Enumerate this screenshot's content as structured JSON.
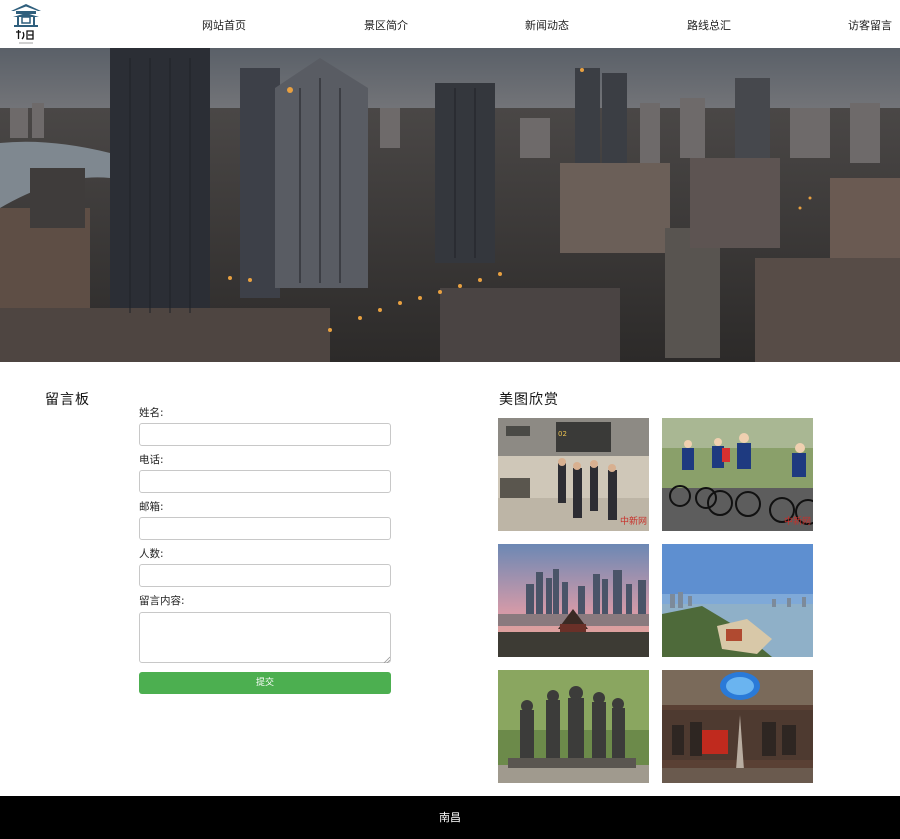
{
  "header": {
    "logo_icon": "nanchang-pavilion-logo",
    "nav": [
      {
        "label": "网站首页"
      },
      {
        "label": "景区简介"
      },
      {
        "label": "新闻动态"
      },
      {
        "label": "路线总汇"
      },
      {
        "label": "访客留言"
      }
    ]
  },
  "hero": {
    "image": "nanchang-city-skyline-dusk"
  },
  "guestbook": {
    "title": "留言板",
    "fields": [
      {
        "label": "姓名:",
        "value": "",
        "placeholder": ""
      },
      {
        "label": "电话:",
        "value": "",
        "placeholder": ""
      },
      {
        "label": "邮箱:",
        "value": "",
        "placeholder": ""
      },
      {
        "label": "人数:",
        "value": "",
        "placeholder": ""
      },
      {
        "label": "留言内容:",
        "value": "",
        "placeholder": ""
      }
    ],
    "submit_label": "提交"
  },
  "gallery": {
    "title": "美图欣赏",
    "photos": [
      {
        "image": "railway-station-ticket-gates",
        "watermark": "中新网"
      },
      {
        "image": "road-cycling-race",
        "watermark": "中新网"
      },
      {
        "image": "city-skyline-sunset-pavilion"
      },
      {
        "image": "river-waterfront-aerial"
      },
      {
        "image": "revolutionary-statue-group"
      },
      {
        "image": "memorial-hall-dome-sculpture"
      }
    ]
  },
  "footer": {
    "text": "南昌"
  },
  "colors": {
    "accent_green": "#4caf50",
    "footer_bg": "#000000",
    "logo_blue": "#2f5f7d"
  }
}
